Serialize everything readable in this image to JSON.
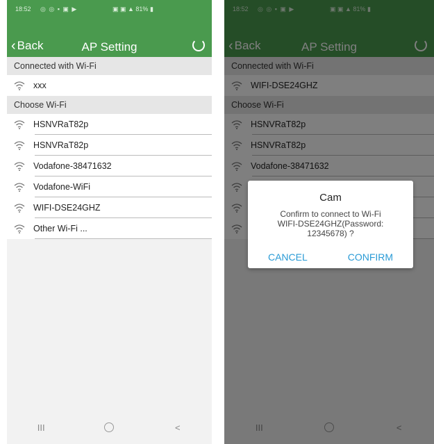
{
  "status_bar": {
    "time": "18:52",
    "battery": "81%"
  },
  "header": {
    "back_label": "Back",
    "title": "AP Setting"
  },
  "left": {
    "connected_section": "Connected with Wi-Fi",
    "connected": [
      "xxx"
    ],
    "choose_section": "Choose Wi-Fi",
    "networks": [
      "HSNVRaT82p",
      "HSNVRaT82p",
      "Vodafone-38471632",
      "Vodafone-WiFi",
      "WIFI-DSE24GHZ",
      "Other Wi-Fi ..."
    ]
  },
  "right": {
    "connected_section": "Connected with Wi-Fi",
    "connected": [
      "WIFI-DSE24GHZ"
    ],
    "choose_section": "Choose Wi-Fi",
    "networks": [
      "HSNVRaT82p",
      "HSNVRaT82p",
      "Vodafone-38471632",
      "",
      "",
      ""
    ]
  },
  "dialog": {
    "title": "Cam",
    "message_line1": "Confirm to connect to Wi-Fi",
    "message_line2": "WIFI-DSE24GHZ(Password:",
    "message_line3": "12345678) ?",
    "cancel_label": "CANCEL",
    "confirm_label": "CONFIRM"
  },
  "navbar": {
    "recents": "III",
    "back": "<"
  },
  "colors": {
    "header": "#4a9a4e",
    "dialog_button": "#2a9bd6",
    "section_bg": "#e6e6e6"
  }
}
